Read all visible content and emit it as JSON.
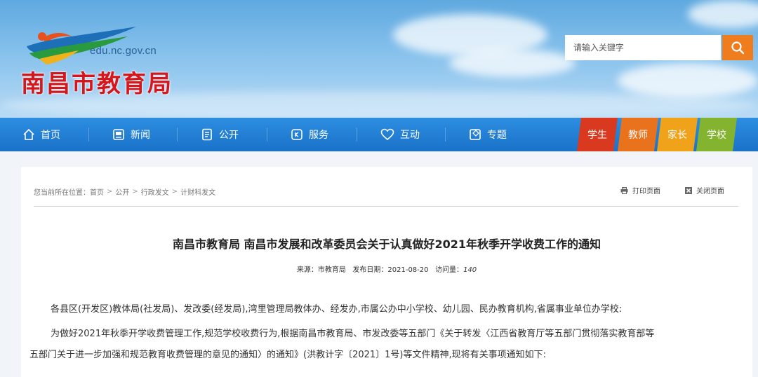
{
  "site": {
    "domain": "edu.nc.gov.cn",
    "title": "南昌市教育局"
  },
  "search": {
    "placeholder": "请输入关键字",
    "icon": "search-icon"
  },
  "nav": {
    "items": [
      {
        "label": "首页",
        "icon": "home-icon"
      },
      {
        "label": "新闻",
        "icon": "news-icon"
      },
      {
        "label": "公开",
        "icon": "document-icon"
      },
      {
        "label": "服务",
        "icon": "service-icon"
      },
      {
        "label": "互动",
        "icon": "heart-icon"
      },
      {
        "label": "专题",
        "icon": "topic-icon"
      }
    ],
    "roles": [
      {
        "label": "学生",
        "color": "#d9391f"
      },
      {
        "label": "教师",
        "color": "#e8731c"
      },
      {
        "label": "家长",
        "color": "#f0a31a"
      },
      {
        "label": "学校",
        "color": "#84b42f"
      }
    ]
  },
  "breadcrumb": {
    "prefix": "您当前所在位置：",
    "items": [
      "首页",
      "公开",
      "行政发文",
      "计财科发文"
    ],
    "separator": ">"
  },
  "tools": {
    "print": "打印页面",
    "close": "关闭页面"
  },
  "article": {
    "title": "南昌市教育局 南昌市发展和改革委员会关于认真做好2021年秋季开学收费工作的通知",
    "meta": {
      "source_label": "来源：",
      "source": "市教育局",
      "date_label": "发布日期：",
      "date": "2021-08-20",
      "views_label": "访问量：",
      "views": "140"
    },
    "paragraphs": [
      "各县区(开发区)教体局(社发局)、发改委(经发局),湾里管理局教体办、经发办,市属公办中小学校、幼儿园、民办教育机构,省属事业单位办学校:",
      "为做好2021年秋季开学收费管理工作,规范学校收费行为,根据南昌市教育局、市发改委等五部门《关于转发〈江西省教育厅等五部门贯彻落实教育部等",
      "五部门关于进一步加强和规范教育收费管理的意见的通知〉的通知》(洪教计字〔2021〕1号)等文件精神,现将有关事项通知如下:"
    ]
  }
}
